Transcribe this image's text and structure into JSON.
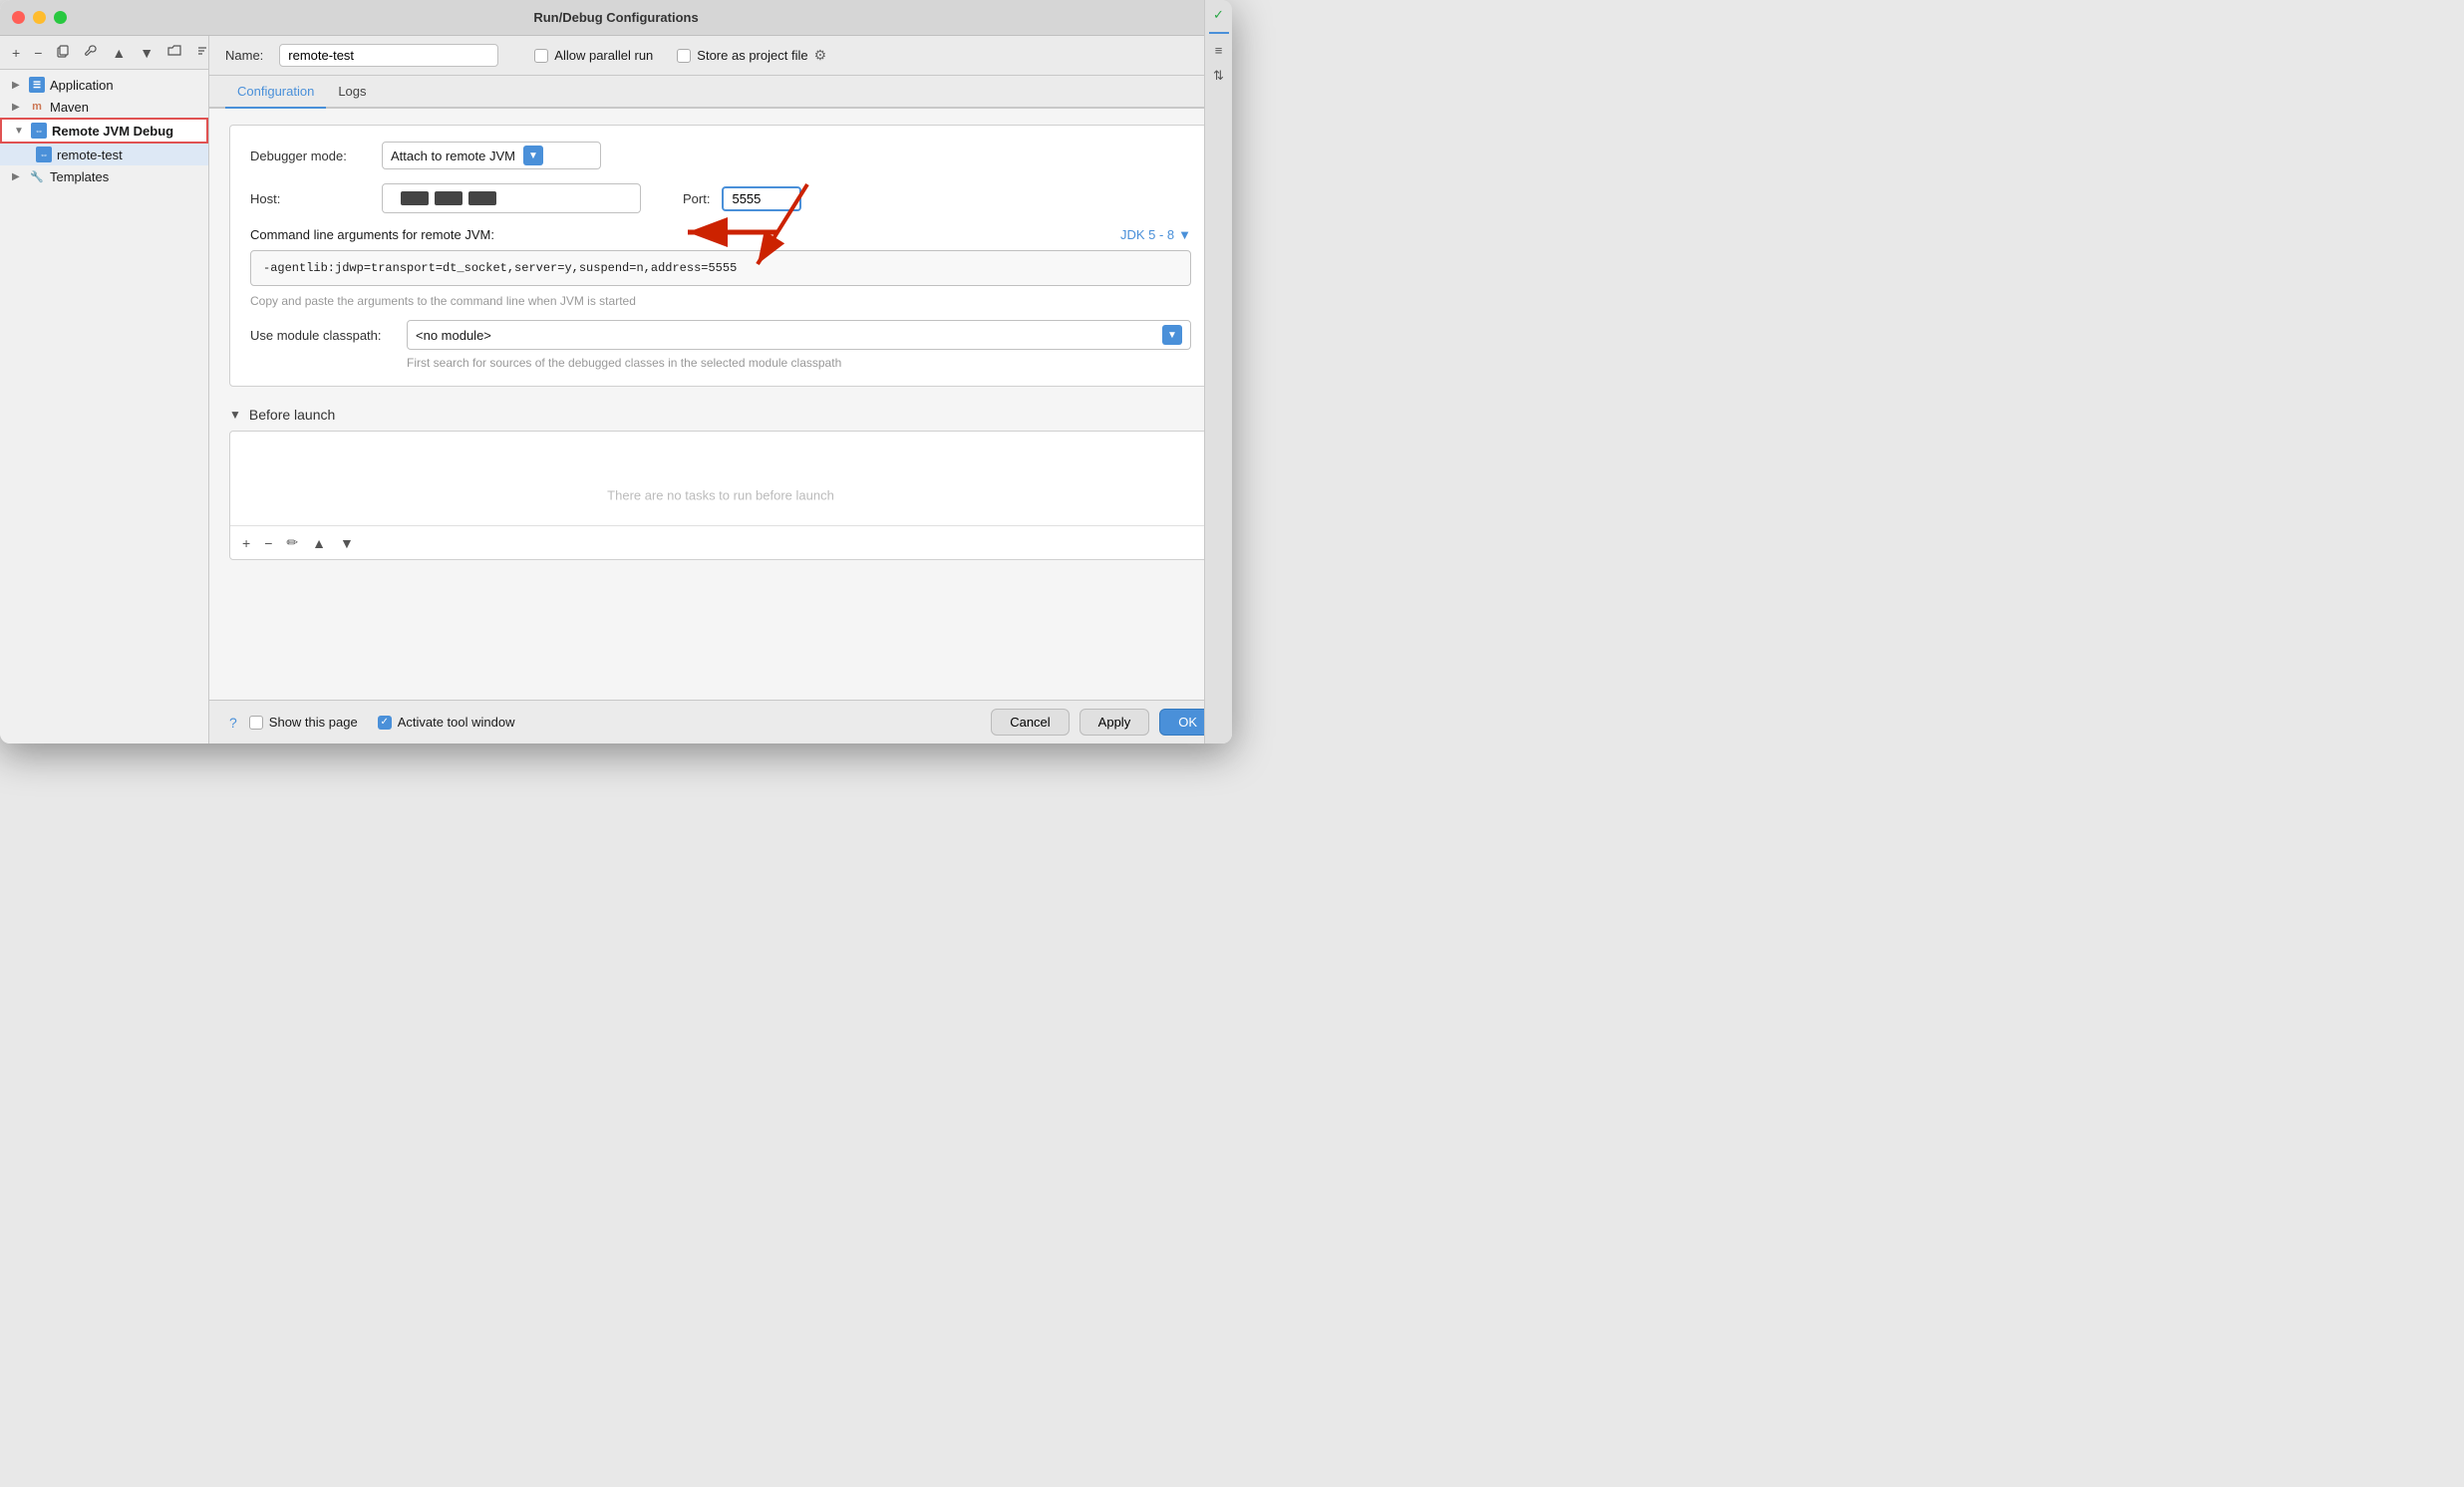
{
  "window": {
    "title": "Run/Debug Configurations"
  },
  "toolbar": {
    "add": "+",
    "remove": "−",
    "copy": "⿻",
    "wrench": "🔧",
    "up": "▲",
    "down": "▼",
    "folder": "📁",
    "sort": "↕"
  },
  "tree": {
    "application_label": "Application",
    "maven_label": "Maven",
    "remote_jvm_debug_label": "Remote JVM Debug",
    "remote_test_label": "remote-test",
    "templates_label": "Templates"
  },
  "header": {
    "name_label": "Name:",
    "name_value": "remote-test",
    "allow_parallel_label": "Allow parallel run",
    "store_project_label": "Store as project file"
  },
  "tabs": {
    "configuration_label": "Configuration",
    "logs_label": "Logs"
  },
  "config": {
    "debugger_mode_label": "Debugger mode:",
    "debugger_mode_value": "Attach to remote JVM",
    "host_label": "Host:",
    "port_label": "Port:",
    "port_value": "5555",
    "cmdline_label": "Command line arguments for remote JVM:",
    "jdk_label": "JDK 5 - 8",
    "cmdline_value": "-agentlib:jdwp=transport=dt_socket,server=y,suspend=n,address=5555",
    "cmdline_hint": "Copy and paste the arguments to the command line when JVM is started",
    "module_label": "Use module classpath:",
    "module_value": "<no module>",
    "module_hint": "First search for sources of the debugged classes in the selected module classpath"
  },
  "before_launch": {
    "label": "Before launch",
    "empty_text": "There are no tasks to run before launch"
  },
  "footer": {
    "show_page_label": "Show this page",
    "activate_window_label": "Activate tool window",
    "cancel_label": "Cancel",
    "apply_label": "Apply",
    "ok_label": "OK"
  }
}
